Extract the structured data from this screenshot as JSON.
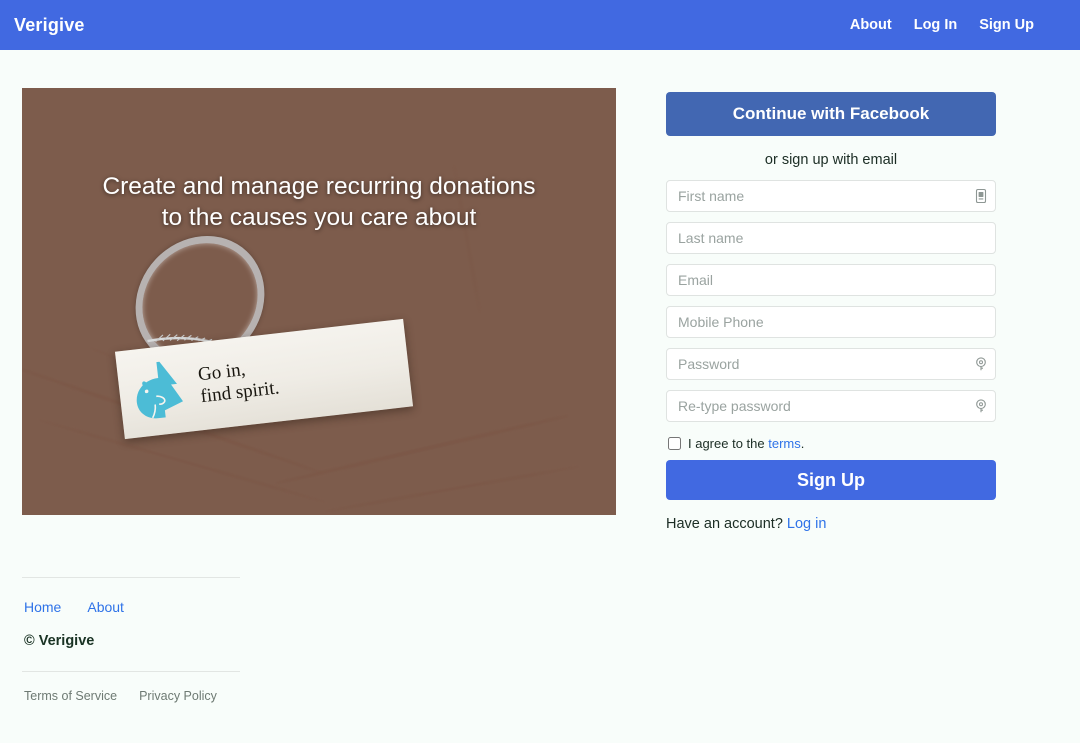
{
  "navbar": {
    "brand": "Verigive",
    "links": [
      {
        "label": "About"
      },
      {
        "label": "Log In"
      },
      {
        "label": "Sign Up"
      }
    ],
    "background_color": "#4169e1"
  },
  "hero": {
    "caption_line1": "Create and manage recurring donations",
    "caption_line2": "to the causes you care about",
    "photo_alt": "Open palm holding a small printed paper slip",
    "slip": {
      "line1": "Go in,",
      "line2": "find spirit.",
      "logo_color": "#4cbcd6"
    }
  },
  "signup": {
    "facebook_button": "Continue with Facebook",
    "facebook_color": "#4267b2",
    "divider_text": "or sign up with email",
    "fields": [
      {
        "name": "first-name",
        "placeholder": "First name",
        "value": "",
        "type": "text",
        "icon": "contact-card-icon"
      },
      {
        "name": "last-name",
        "placeholder": "Last name",
        "value": "",
        "type": "text",
        "icon": ""
      },
      {
        "name": "email",
        "placeholder": "Email",
        "value": "",
        "type": "text",
        "icon": ""
      },
      {
        "name": "phone",
        "placeholder": "Mobile Phone",
        "value": "",
        "type": "text",
        "icon": ""
      },
      {
        "name": "password",
        "placeholder": "Password",
        "value": "",
        "type": "password",
        "icon": "key-icon"
      },
      {
        "name": "confirm",
        "placeholder": "Re-type password",
        "value": "",
        "type": "password",
        "icon": "key-icon"
      }
    ],
    "terms_prefix": "I agree to the ",
    "terms_link": "terms",
    "terms_suffix": ".",
    "terms_checked": false,
    "submit_label": "Sign Up",
    "submit_color": "#4169e1",
    "have_account_text": "Have an account? ",
    "have_account_link": "Log in",
    "link_color": "#2f73e8"
  },
  "footer": {
    "links": [
      {
        "label": "Home"
      },
      {
        "label": "About"
      }
    ],
    "copyright": "© Verigive",
    "legal": [
      {
        "label": "Terms of Service"
      },
      {
        "label": "Privacy Policy"
      }
    ]
  }
}
